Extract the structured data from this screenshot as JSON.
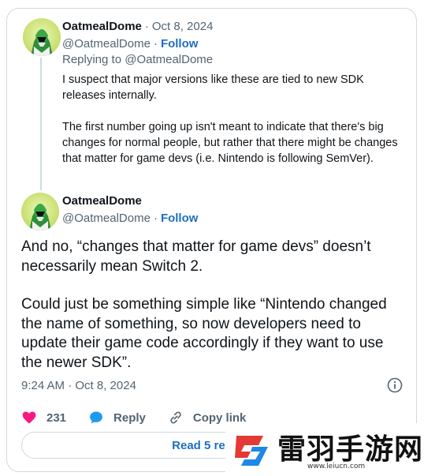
{
  "reply_tweet": {
    "display_name": "OatmealDome",
    "date": "Oct 8, 2024",
    "handle": "@OatmealDome",
    "follow_label": "Follow",
    "replying_to": "Replying to @OatmealDome",
    "paragraphs": [
      "I suspect that major versions like these are tied to new SDK releases internally.",
      "The first number going up isn't meant to indicate that there's big changes for normal people, but rather that there might be changes that matter for game devs (i.e. Nintendo is following SemVer)."
    ]
  },
  "main_tweet": {
    "display_name": "OatmealDome",
    "handle": "@OatmealDome",
    "follow_label": "Follow",
    "paragraphs": [
      "And no, “changes that matter for game devs” doesn’t necessarily mean Switch 2.",
      "Could just be something simple like “Nintendo changed the name of something, so now developers need to update their game code accordingly if they want to use the newer SDK”."
    ],
    "timestamp": "9:24 AM · Oct 8, 2024"
  },
  "actions": {
    "like_count": "231",
    "reply_label": "Reply",
    "copy_link_label": "Copy link"
  },
  "read_replies_label": "Read 5 replies",
  "watermark": {
    "title": "雷羽手游网",
    "url": "www.leiucn.com"
  },
  "colors": {
    "like": "#f91880",
    "reply": "#1d9bf0",
    "link": "#1d6fc2",
    "secondary_text": "#536471"
  },
  "icons": [
    "avatar-image",
    "heart-icon",
    "speech-bubble-icon",
    "link-icon",
    "info-icon",
    "watermark-logo"
  ]
}
